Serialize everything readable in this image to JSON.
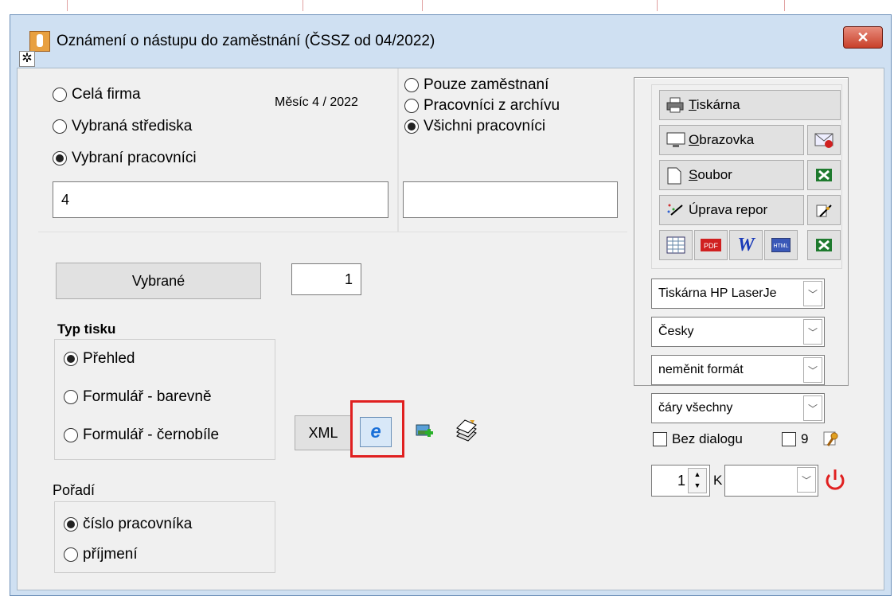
{
  "window": {
    "title": "Oznámení o nástupu do zaměstnání (ČSSZ od 04/2022)",
    "close_label": "✕"
  },
  "scope": {
    "options": [
      "Celá firma",
      "Vybraná střediska",
      "Vybraní pracovníci"
    ],
    "selected": 2,
    "month_label": "Měsíc  4 / 2022",
    "value": "4"
  },
  "employees": {
    "options": [
      "Pouze zaměstnaní",
      "Pracovníci z archívu",
      "Všichni pracovníci"
    ],
    "selected": 2,
    "value": ""
  },
  "selected_button": {
    "label": "Vybrané",
    "count": "1"
  },
  "print_type": {
    "heading": "Typ tisku",
    "options": [
      "Přehled",
      "Formulář - barevně",
      "Formulář - černobíle"
    ],
    "selected": 0
  },
  "xml_label": "XML",
  "order": {
    "heading": "Pořadí",
    "options": [
      "číslo pracovníka",
      "příjmení"
    ],
    "selected": 0
  },
  "output": {
    "printer_label": "Tiskárna",
    "printer_key": "T",
    "screen_label": "Obrazovka",
    "screen_key": "O",
    "file_label": "Soubor",
    "file_key": "S",
    "edit_label": "Úprava repor",
    "printer_select": "Tiskárna HP LaserJe",
    "language_select": "Česky",
    "format_select": "neměnit formát",
    "lines_select": "čáry všechny",
    "no_dialog_label": "Bez dialogu",
    "copies_extra": "9",
    "copies": "1",
    "k_label": "K",
    "k_select": ""
  },
  "colors": {
    "accent_red": "#e02020",
    "title_bg": "#cfe0f2"
  }
}
